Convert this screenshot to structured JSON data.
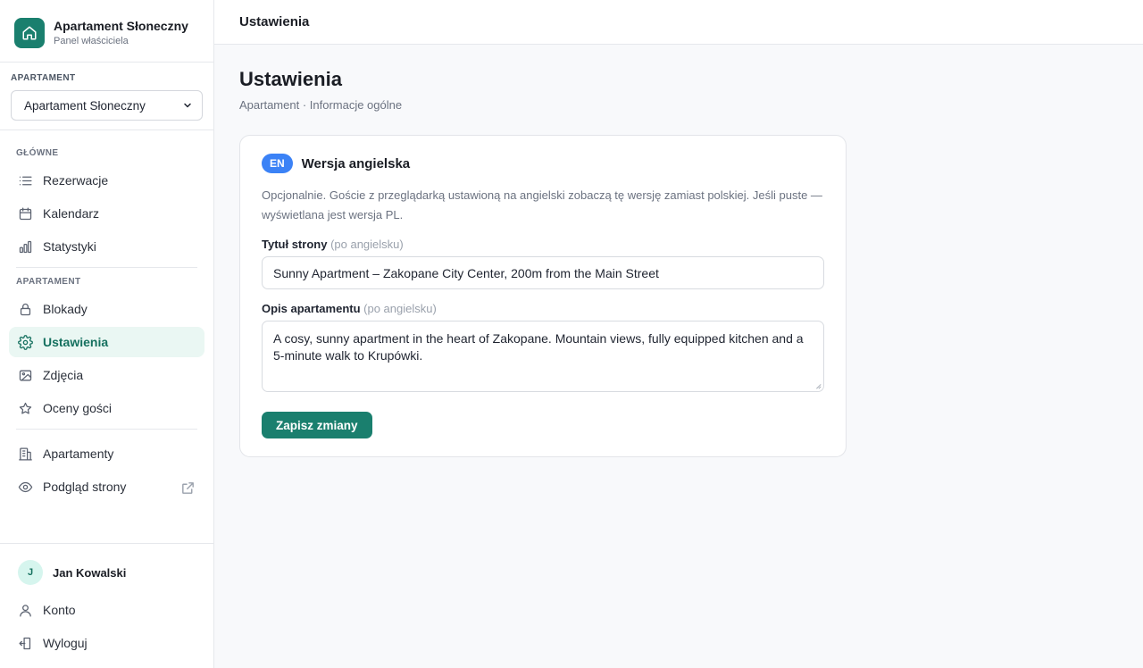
{
  "brand": {
    "title": "Apartament Słoneczny",
    "subtitle": "Panel właściciela",
    "icon": "home-icon"
  },
  "apartment_selector": {
    "label": "APARTAMENT",
    "value": "Apartament Słoneczny"
  },
  "nav": {
    "main_label": "GŁÓWNE",
    "main_items": [
      {
        "label": "Rezerwacje",
        "icon": "list-icon"
      },
      {
        "label": "Kalendarz",
        "icon": "calendar-icon"
      },
      {
        "label": "Statystyki",
        "icon": "bar-chart-icon"
      }
    ],
    "apartment_label": "APARTAMENT",
    "apartment_items": [
      {
        "label": "Blokady",
        "icon": "lock-icon"
      },
      {
        "label": "Ustawienia",
        "icon": "gear-icon",
        "active": true
      },
      {
        "label": "Zdjęcia",
        "icon": "image-icon"
      },
      {
        "label": "Oceny gości",
        "icon": "star-icon"
      }
    ],
    "other_items": [
      {
        "label": "Apartamenty",
        "icon": "building-icon"
      },
      {
        "label": "Podgląd strony",
        "icon": "eye-icon"
      }
    ]
  },
  "user": {
    "initial": "J",
    "name": "Jan Kowalski",
    "account_label": "Konto",
    "logout_label": "Wyloguj"
  },
  "topbar": {
    "title": "Ustawienia"
  },
  "page": {
    "title": "Ustawienia",
    "breadcrumb": "Apartament · Informacje ogólne"
  },
  "card": {
    "badge": "EN",
    "title": "Wersja angielska",
    "description": "Opcjonalnie. Goście z przeglądarką ustawioną na angielski zobaczą tę wersję zamiast polskiej. Jeśli puste — wyświetlana jest wersja PL.",
    "title_field": {
      "label": "Tytuł strony",
      "hint": "(po angielsku)",
      "value": "Sunny Apartment – Zakopane City Center, 200m from the Main Street"
    },
    "desc_field": {
      "label": "Opis apartamentu",
      "hint": "(po angielsku)",
      "value": "A cosy, sunny apartment in the heart of Zakopane. Mountain views, fully equipped kitchen and a 5-minute walk to Krupówki."
    },
    "save_label": "Zapisz zmiany"
  },
  "colors": {
    "accent": "#1a7f6e",
    "badge": "#3b82f6",
    "active_bg": "#eaf7f3"
  }
}
